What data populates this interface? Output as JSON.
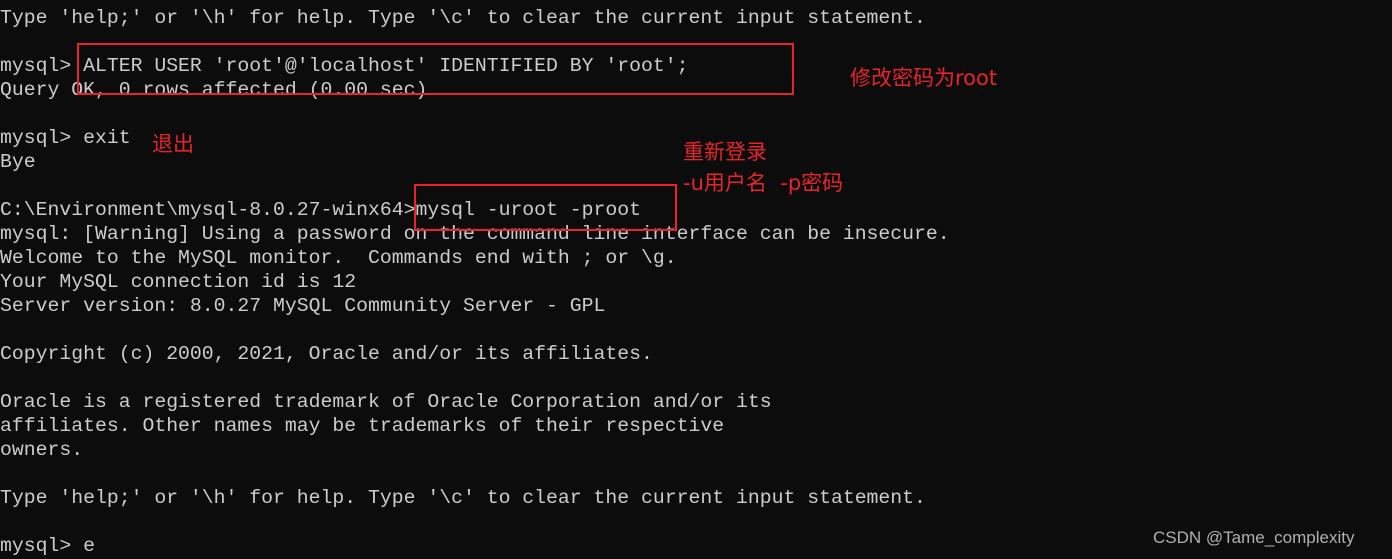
{
  "terminal": {
    "lines": [
      "Type 'help;' or '\\h' for help. Type '\\c' to clear the current input statement.",
      "",
      "mysql> ALTER USER 'root'@'localhost' IDENTIFIED BY 'root';",
      "Query OK, 0 rows affected (0.00 sec)",
      "",
      "mysql> exit",
      "Bye",
      "",
      "C:\\Environment\\mysql-8.0.27-winx64>mysql -uroot -proot",
      "mysql: [Warning] Using a password on the command line interface can be insecure.",
      "Welcome to the MySQL monitor.  Commands end with ; or \\g.",
      "Your MySQL connection id is 12",
      "Server version: 8.0.27 MySQL Community Server - GPL",
      "",
      "Copyright (c) 2000, 2021, Oracle and/or its affiliates.",
      "",
      "Oracle is a registered trademark of Oracle Corporation and/or its",
      "affiliates. Other names may be trademarks of their respective",
      "owners.",
      "",
      "Type 'help;' or '\\h' for help. Type '\\c' to clear the current input statement.",
      "",
      "mysql> e"
    ]
  },
  "annotations": {
    "change_password": "修改密码为root",
    "exit": "退出",
    "relogin_title": "重新登录",
    "relogin_hint": "-u用户名  -p密码",
    "color": "#e8242b"
  },
  "watermark": "CSDN @Tame_complexity",
  "colors": {
    "background": "#0c0c0c",
    "text": "#cccccc"
  }
}
